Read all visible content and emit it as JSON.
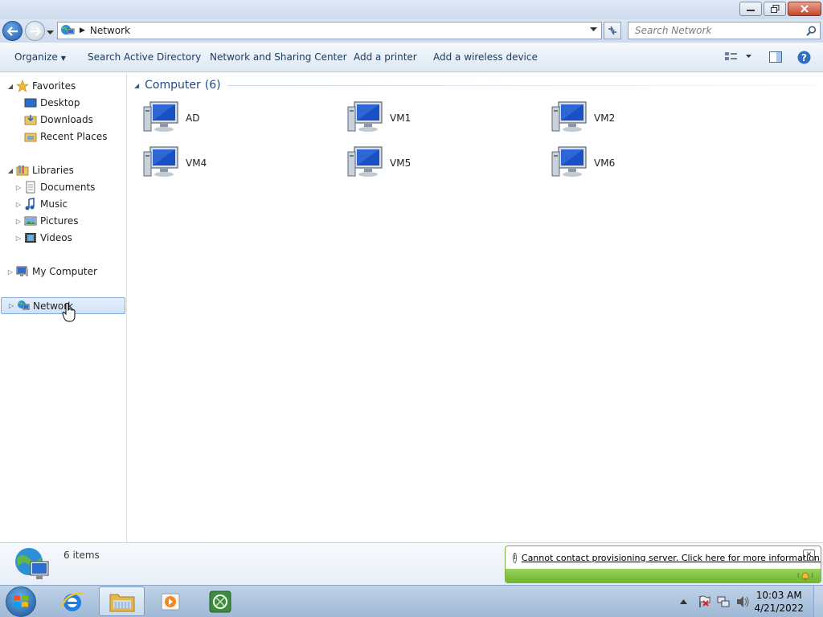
{
  "window": {
    "address": {
      "crumb": "Network"
    },
    "search": {
      "placeholder": "Search Network"
    }
  },
  "commandbar": {
    "organize": "Organize",
    "items": [
      "Search Active Directory",
      "Network and Sharing Center",
      "Add a printer",
      "Add a wireless device"
    ]
  },
  "navpane": {
    "favorites": {
      "label": "Favorites",
      "items": [
        "Desktop",
        "Downloads",
        "Recent Places"
      ]
    },
    "libraries": {
      "label": "Libraries",
      "items": [
        "Documents",
        "Music",
        "Pictures",
        "Videos"
      ]
    },
    "computer": "My Computer",
    "network": "Network"
  },
  "content": {
    "group": {
      "title": "Computer",
      "count": "(6)"
    },
    "computers": [
      "AD",
      "VM1",
      "VM2",
      "VM4",
      "VM5",
      "VM6"
    ]
  },
  "details": {
    "count": "6 items"
  },
  "notification": {
    "message": "Cannot contact provisioning server.  Click here for more information."
  },
  "taskbar": {
    "time": "10:03 AM",
    "date": "4/21/2022"
  }
}
